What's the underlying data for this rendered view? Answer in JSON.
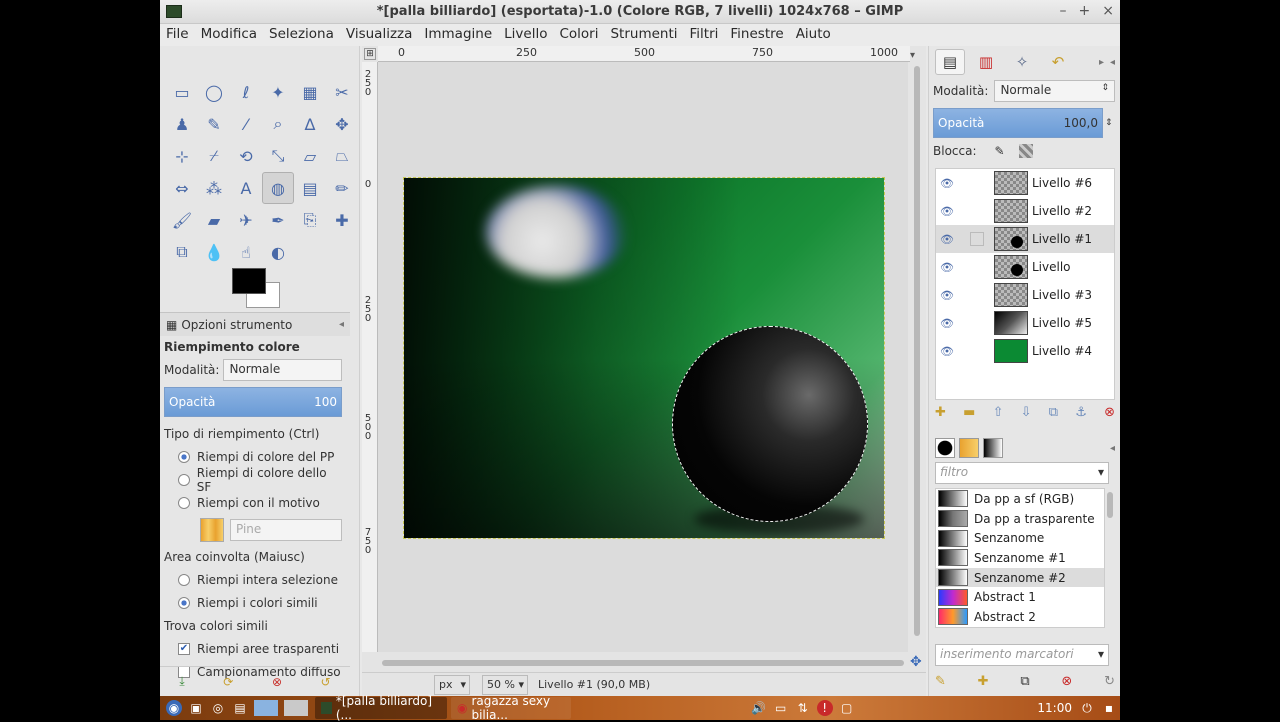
{
  "window": {
    "title": "*[palla billiardo] (esportata)-1.0 (Colore RGB, 7 livelli) 1024x768 – GIMP",
    "controls": [
      "–",
      "+",
      "×"
    ]
  },
  "menu": [
    "File",
    "Modifica",
    "Seleziona",
    "Visualizza",
    "Immagine",
    "Livello",
    "Colori",
    "Strumenti",
    "Filtri",
    "Finestre",
    "Aiuto"
  ],
  "toolbox": {
    "tools": [
      {
        "icon": "rect-select-icon",
        "glyph": "▭"
      },
      {
        "icon": "ellipse-select-icon",
        "glyph": "◯"
      },
      {
        "icon": "lasso-icon",
        "glyph": "ℓ"
      },
      {
        "icon": "fuzzy-select-icon",
        "glyph": "✦"
      },
      {
        "icon": "color-select-icon",
        "glyph": "▦"
      },
      {
        "icon": "scissors-icon",
        "glyph": "✂"
      },
      {
        "icon": "foreground-select-icon",
        "glyph": "♟"
      },
      {
        "icon": "paths-icon",
        "glyph": "✎"
      },
      {
        "icon": "color-picker-icon",
        "glyph": "⁄"
      },
      {
        "icon": "zoom-icon",
        "glyph": "⌕"
      },
      {
        "icon": "measure-icon",
        "glyph": "∆"
      },
      {
        "icon": "move-icon",
        "glyph": "✥"
      },
      {
        "icon": "align-icon",
        "glyph": "⊹"
      },
      {
        "icon": "crop-icon",
        "glyph": "⌿"
      },
      {
        "icon": "rotate-icon",
        "glyph": "⟲"
      },
      {
        "icon": "scale-icon",
        "glyph": "⤡"
      },
      {
        "icon": "shear-icon",
        "glyph": "▱"
      },
      {
        "icon": "perspective-icon",
        "glyph": "⏢"
      },
      {
        "icon": "flip-icon",
        "glyph": "⇔"
      },
      {
        "icon": "cage-icon",
        "glyph": "⁂"
      },
      {
        "icon": "text-icon",
        "glyph": "A"
      },
      {
        "icon": "bucket-fill-icon",
        "glyph": "◍"
      },
      {
        "icon": "blend-icon",
        "glyph": "▤"
      },
      {
        "icon": "pencil-icon",
        "glyph": "✏"
      },
      {
        "icon": "paintbrush-icon",
        "glyph": "🖌"
      },
      {
        "icon": "eraser-icon",
        "glyph": "▰"
      },
      {
        "icon": "airbrush-icon",
        "glyph": "✈"
      },
      {
        "icon": "ink-icon",
        "glyph": "✒"
      },
      {
        "icon": "clone-icon",
        "glyph": "⎘"
      },
      {
        "icon": "heal-icon",
        "glyph": "✚"
      },
      {
        "icon": "perspective-clone-icon",
        "glyph": "⧉"
      },
      {
        "icon": "blur-icon",
        "glyph": "💧"
      },
      {
        "icon": "smudge-icon",
        "glyph": "☝"
      },
      {
        "icon": "dodge-burn-icon",
        "glyph": "◐"
      }
    ],
    "active_tool_index": 21,
    "fg_color": "#000000",
    "bg_color": "#ffffff"
  },
  "tool_options": {
    "header": "Opzioni strumento",
    "title": "Riempimento colore",
    "mode_label": "Modalità:",
    "mode_value": "Normale",
    "opacity_label": "Opacità",
    "opacity_value": "100",
    "fill_type_label": "Tipo di riempimento (Ctrl)",
    "fill_options": [
      {
        "label": "Riempi di colore del PP",
        "checked": true
      },
      {
        "label": "Riempi di colore dello SF",
        "checked": false
      },
      {
        "label": "Riempi con il motivo",
        "checked": false
      }
    ],
    "pattern_name": "Pine",
    "area_label": "Area coinvolta (Maiusc)",
    "area_options": [
      {
        "label": "Riempi intera selezione",
        "checked": false
      },
      {
        "label": "Riempi i colori simili",
        "checked": true
      }
    ],
    "similar_label": "Trova colori simili",
    "similar_options": [
      {
        "label": "Riempi aree trasparenti",
        "checked": true
      },
      {
        "label": "Campionamento diffuso",
        "checked": false
      }
    ]
  },
  "rulers": {
    "h": [
      "0",
      "250",
      "500",
      "750",
      "1000"
    ],
    "v": [
      "2\n5\n0",
      "0",
      "2\n5\n0",
      "5\n0\n0",
      "7\n5\n0"
    ]
  },
  "status": {
    "unit": "px",
    "zoom": "50 %",
    "message": "Livello #1 (90,0 MB)"
  },
  "layers_panel": {
    "mode_label": "Modalità:",
    "mode_value": "Normale",
    "opacity_label": "Opacità",
    "opacity_value": "100,0",
    "lock_label": "Blocca:",
    "layers": [
      {
        "name": "Livello #6",
        "visible": true,
        "selected": false,
        "thumb": "checker"
      },
      {
        "name": "Livello #2",
        "visible": true,
        "selected": false,
        "thumb": "checker"
      },
      {
        "name": "Livello #1",
        "visible": true,
        "selected": true,
        "thumb": "checker-ball"
      },
      {
        "name": "Livello",
        "visible": true,
        "selected": false,
        "thumb": "checker-8ball"
      },
      {
        "name": "Livello #3",
        "visible": true,
        "selected": false,
        "thumb": "checker"
      },
      {
        "name": "Livello #5",
        "visible": true,
        "selected": false,
        "thumb": "dark-gradient"
      },
      {
        "name": "Livello #4",
        "visible": true,
        "selected": false,
        "thumb": "green"
      }
    ]
  },
  "gradients_panel": {
    "filter_placeholder": "filtro",
    "tags_placeholder": "inserimento marcatori",
    "gradients": [
      {
        "name": "Da pp a sf (RGB)",
        "selected": false
      },
      {
        "name": "Da pp a trasparente",
        "selected": false
      },
      {
        "name": "Senzanome",
        "selected": false
      },
      {
        "name": "Senzanome #1",
        "selected": false
      },
      {
        "name": "Senzanome #2",
        "selected": true
      },
      {
        "name": "Abstract 1",
        "selected": false
      },
      {
        "name": "Abstract 2",
        "selected": false
      }
    ]
  },
  "taskbar": {
    "tasks": [
      "*[palla billiardo] (...",
      "ragazza sexy bilia..."
    ],
    "clock": "11:00"
  }
}
